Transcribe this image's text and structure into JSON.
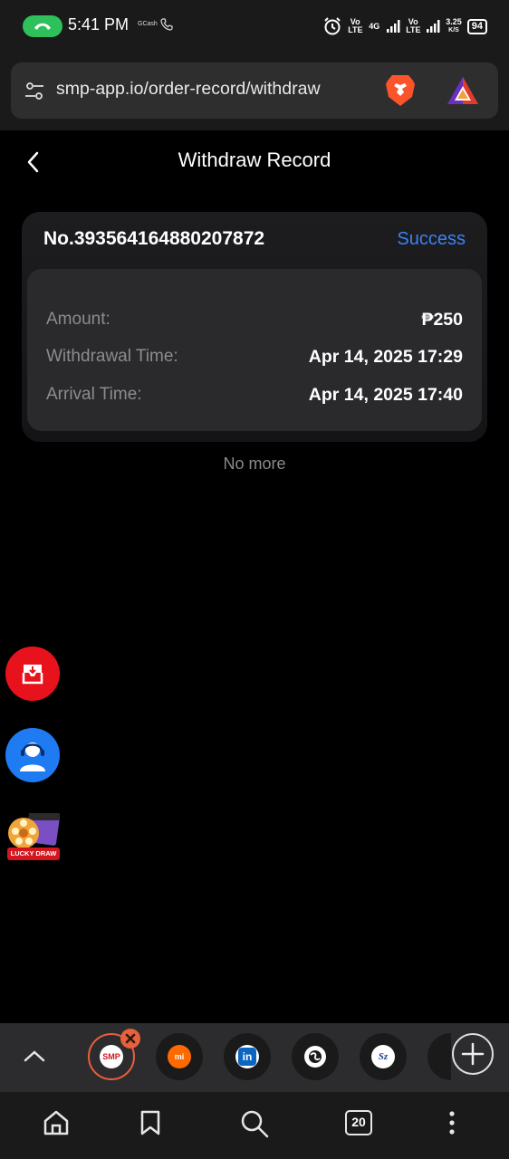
{
  "status_bar": {
    "time": "5:41 PM",
    "notification_label": "GCash",
    "network_volte_1": "Vo LTE",
    "network_4g": "4G",
    "network_volte_2": "Vo LTE",
    "speed_value": "3.25",
    "speed_unit": "K/S",
    "battery": "94"
  },
  "browser": {
    "url": "smp-app.io/order-record/withdraw",
    "tab_count": "20"
  },
  "page": {
    "title": "Withdraw Record"
  },
  "record": {
    "order_number": "No.393564164880207872",
    "status": "Success",
    "rows": [
      {
        "label": "Amount:",
        "value": "₱250"
      },
      {
        "label": "Withdrawal Time:",
        "value": "Apr 14, 2025 17:29"
      },
      {
        "label": "Arrival Time:",
        "value": "Apr 14, 2025 17:40"
      }
    ]
  },
  "list_footer": "No more",
  "floating": {
    "lucky_draw_label": "LUCKY DRAW"
  },
  "tabs": [
    {
      "name": "smp-app",
      "icon": "smp-logo-icon",
      "logo_text": "SMP"
    },
    {
      "name": "mi",
      "icon": "mi-logo-icon",
      "logo_text": "mi"
    },
    {
      "name": "linkedin",
      "icon": "linkedin-logo-icon",
      "logo_text": "in"
    },
    {
      "name": "globe",
      "icon": "globe-icon"
    },
    {
      "name": "sz",
      "icon": "sz-logo-icon",
      "logo_text": "Sz"
    }
  ],
  "colors": {
    "accent_blue": "#3b82f6",
    "brand_red": "#e8121d",
    "active_tab_orange": "#e8603c"
  }
}
